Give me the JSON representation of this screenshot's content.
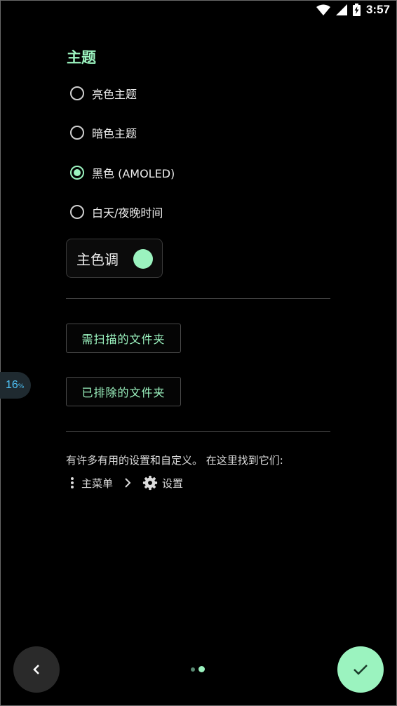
{
  "status_bar": {
    "time": "3:57",
    "icons": [
      "wifi-icon",
      "cell-signal-icon",
      "battery-charging-icon"
    ]
  },
  "theme": {
    "title": "主题",
    "options": [
      {
        "label": "亮色主题",
        "selected": false
      },
      {
        "label": "暗色主题",
        "selected": false
      },
      {
        "label": "黑色 (AMOLED)",
        "selected": true
      },
      {
        "label": "白天/夜晚时间",
        "selected": false
      }
    ],
    "accent": {
      "label": "主色调",
      "color": "#9bf3bf"
    }
  },
  "folders": {
    "scan_label": "需扫描的文件夹",
    "excluded_label": "已排除的文件夹"
  },
  "progress": {
    "value": "16",
    "unit": "%"
  },
  "hint": {
    "text": "有许多有用的设置和自定义。 在这里找到它们:",
    "menu_label": "主菜单",
    "settings_label": "设置"
  },
  "navigation": {
    "pages": 2,
    "current_page": 2
  },
  "colors": {
    "accent": "#9bf3bf",
    "background": "#000000"
  }
}
